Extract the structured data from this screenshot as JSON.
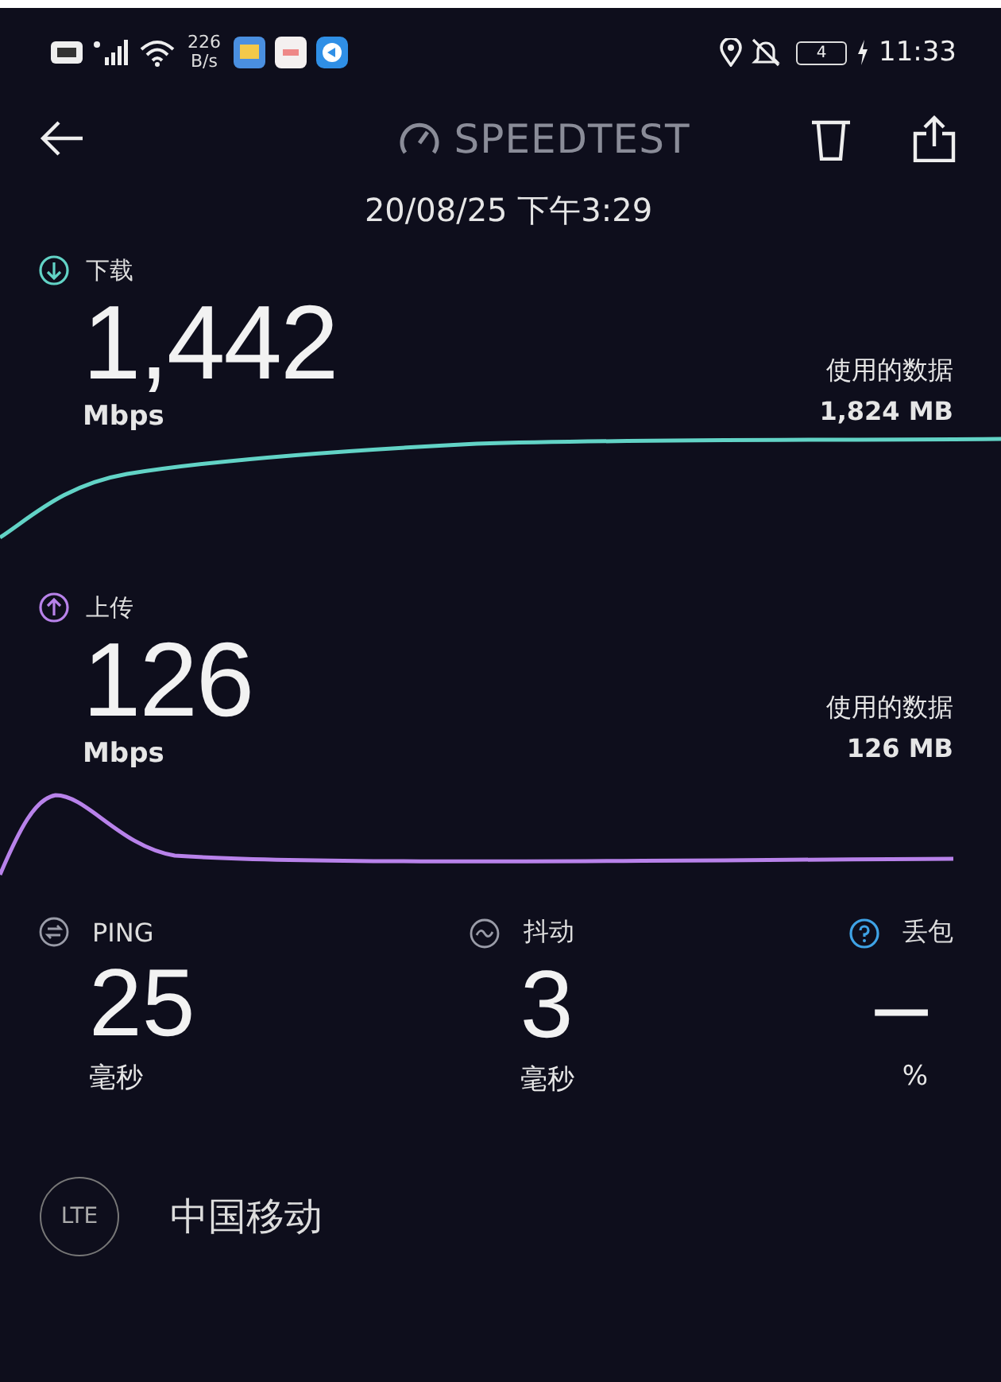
{
  "status_bar": {
    "net_speed": "226",
    "net_speed_unit": "B/s",
    "battery": "4",
    "time": "11:33"
  },
  "header": {
    "title": "SPEEDTEST",
    "date": "20/08/25 下午3:29"
  },
  "results": [
    {
      "kind": "download",
      "label": "下载",
      "value": "1,442",
      "unit": "Mbps",
      "data_label": "使用的数据",
      "data_value": "1,824 MB"
    },
    {
      "kind": "upload",
      "label": "上传",
      "value": "126",
      "unit": "Mbps",
      "data_label": "使用的数据",
      "data_value": "126 MB"
    }
  ],
  "metrics": [
    {
      "kind": "ping",
      "label": "PING",
      "value": "25",
      "unit": "毫秒"
    },
    {
      "kind": "jitter",
      "label": "抖动",
      "value": "3",
      "unit": "毫秒"
    },
    {
      "kind": "loss",
      "label": "丢包",
      "value": "–",
      "unit": "%"
    }
  ],
  "network": {
    "type": "LTE",
    "carrier": "中国移动"
  }
}
